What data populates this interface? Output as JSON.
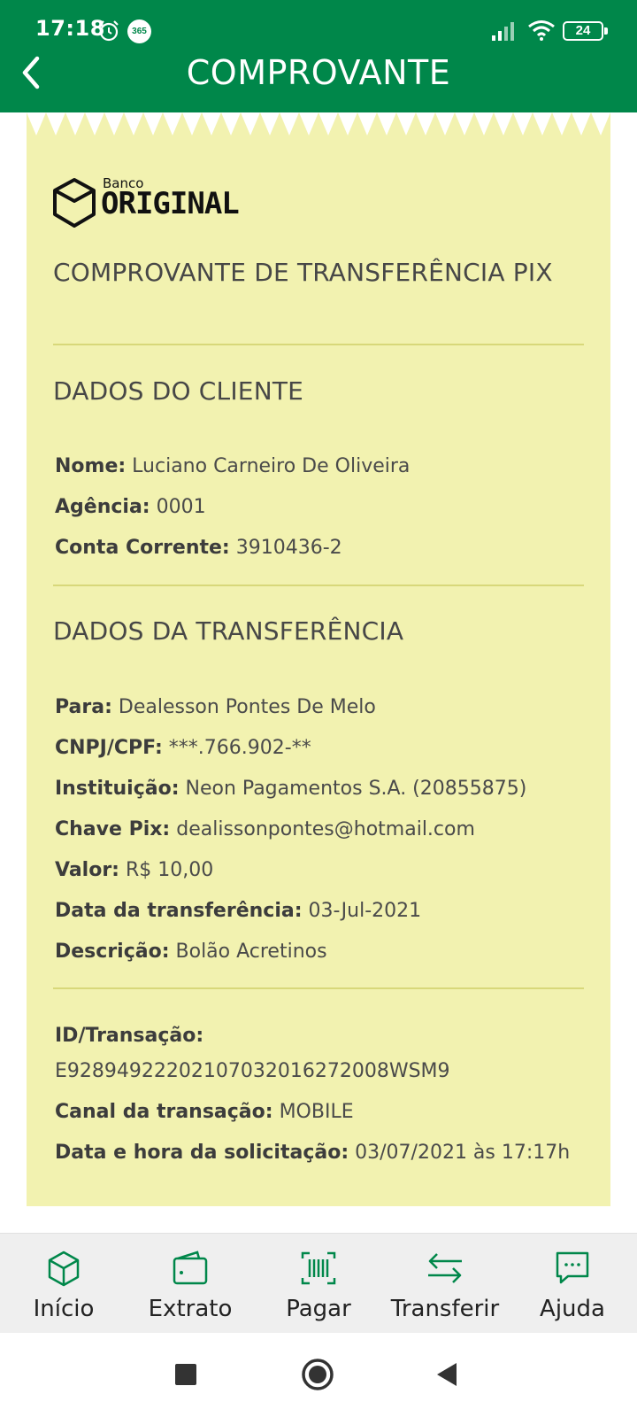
{
  "status_bar": {
    "time": "17:18",
    "badge": "365",
    "battery": "24"
  },
  "header": {
    "title": "COMPROVANTE"
  },
  "receipt": {
    "logo": {
      "small": "Banco",
      "big": "ORIGINAL"
    },
    "title": "COMPROVANTE DE TRANSFERÊNCIA PIX",
    "client_section": {
      "heading": "DADOS DO CLIENTE",
      "rows": [
        {
          "label": "Nome:",
          "value": "Luciano Carneiro De Oliveira"
        },
        {
          "label": "Agência:",
          "value": "0001"
        },
        {
          "label": "Conta Corrente:",
          "value": "3910436-2"
        }
      ]
    },
    "transfer_section": {
      "heading": "DADOS DA TRANSFERÊNCIA",
      "rows": [
        {
          "label": "Para:",
          "value": "Dealesson Pontes De Melo"
        },
        {
          "label": "CNPJ/CPF:",
          "value": "***.766.902-**"
        },
        {
          "label": "Instituição:",
          "value": "Neon Pagamentos S.A. (20855875)"
        },
        {
          "label": "Chave Pix:",
          "value": "dealissonpontes@hotmail.com"
        },
        {
          "label": "Valor:",
          "value": "R$ 10,00"
        },
        {
          "label": "Data da transferência:",
          "value": "03-Jul-2021"
        },
        {
          "label": "Descrição:",
          "value": "Bolão Acretinos"
        }
      ]
    },
    "transaction": {
      "id_label": "ID/Transação:",
      "id_value": "E92894922202107032016272008WSM9",
      "channel_label": "Canal da transação:",
      "channel_value": "MOBILE",
      "datetime_label": "Data e hora da solicitação:",
      "datetime_value": "03/07/2021 às 17:17h"
    }
  },
  "bottom_nav": [
    {
      "label": "Início",
      "icon": "cube-icon"
    },
    {
      "label": "Extrato",
      "icon": "wallet-icon"
    },
    {
      "label": "Pagar",
      "icon": "barcode-icon"
    },
    {
      "label": "Transferir",
      "icon": "transfer-arrows-icon"
    },
    {
      "label": "Ajuda",
      "icon": "chat-icon"
    }
  ],
  "colors": {
    "brand_green": "#00874a",
    "receipt_bg": "#f2f2b0",
    "divider": "#d8d87a"
  }
}
